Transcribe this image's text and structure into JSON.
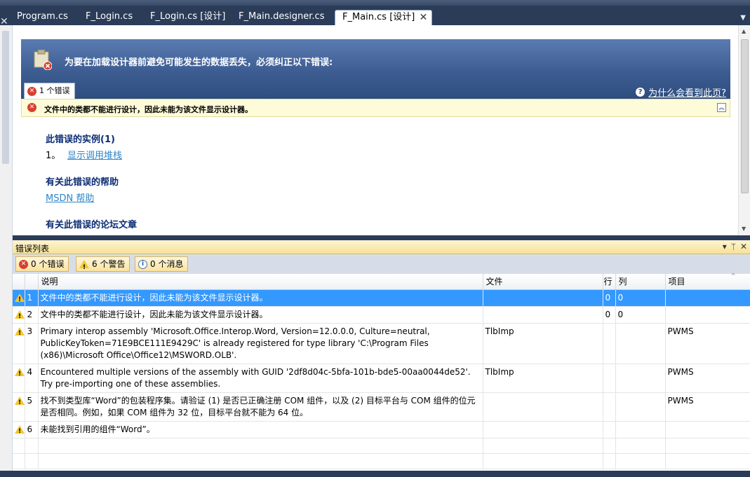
{
  "tabs": [
    {
      "label": "Program.cs",
      "active": false
    },
    {
      "label": "F_Login.cs",
      "active": false
    },
    {
      "label": "F_Login.cs [设计]",
      "active": false
    },
    {
      "label": "F_Main.designer.cs",
      "active": false
    },
    {
      "label": "F_Main.cs [设计]",
      "active": true
    }
  ],
  "designer": {
    "banner_title": "为要在加载设计器前避免可能发生的数据丢失，必须纠正以下错误:",
    "error_tab_label": "1 个错误",
    "why_link": "为什么会看到此页?",
    "error_message": "文件中的类都不能进行设计，因此未能为该文件显示设计器。",
    "instances_heading": "此错误的实例(1)",
    "instance_number": "1。",
    "instance_link": "显示调用堆栈",
    "help_heading": "有关此错误的帮助",
    "help_link": "MSDN 帮助",
    "forum_heading": "有关此错误的论坛文章"
  },
  "error_list": {
    "title": "错误列表",
    "filters": {
      "errors": "0 个错误",
      "warnings": "6 个警告",
      "messages": "0 个消息"
    },
    "columns": {
      "num": "",
      "desc": "说明",
      "file": "文件",
      "line": "行",
      "col": "列",
      "project": "项目"
    },
    "rows": [
      {
        "num": "1",
        "desc": "文件中的类都不能进行设计，因此未能为该文件显示设计器。",
        "file": "",
        "line": "0",
        "col": "0",
        "project": "",
        "selected": true
      },
      {
        "num": "2",
        "desc": "文件中的类都不能进行设计，因此未能为该文件显示设计器。",
        "file": "",
        "line": "0",
        "col": "0",
        "project": "",
        "selected": false
      },
      {
        "num": "3",
        "desc": "Primary interop assembly 'Microsoft.Office.Interop.Word, Version=12.0.0.0, Culture=neutral, PublicKeyToken=71E9BCE111E9429C' is already registered for type library 'C:\\Program Files (x86)\\Microsoft Office\\Office12\\MSWORD.OLB'.",
        "file": "TlbImp",
        "line": "",
        "col": "",
        "project": "PWMS",
        "selected": false
      },
      {
        "num": "4",
        "desc": "Encountered multiple versions of the assembly with GUID '2df8d04c-5bfa-101b-bde5-00aa0044de52'.  Try pre-importing one of these assemblies.",
        "file": "TlbImp",
        "line": "",
        "col": "",
        "project": "PWMS",
        "selected": false
      },
      {
        "num": "5",
        "desc": "找不到类型库“Word”的包装程序集。请验证 (1) 是否已正确注册 COM 组件，以及 (2) 目标平台与 COM 组件的位元是否相同。例如，如果 COM 组件为 32 位，目标平台就不能为 64 位。",
        "file": "",
        "line": "",
        "col": "",
        "project": "PWMS",
        "selected": false
      },
      {
        "num": "6",
        "desc": "未能找到引用的组件“Word”。",
        "file": "",
        "line": "",
        "col": "",
        "project": "",
        "selected": false
      }
    ]
  },
  "colors": {
    "accent": "#3399ff",
    "banner": "#3d5d92",
    "panel_bg": "#2b3c59"
  },
  "icons": {
    "error": "error-icon",
    "warning": "warning-icon",
    "info": "info-icon",
    "help": "help-icon"
  }
}
